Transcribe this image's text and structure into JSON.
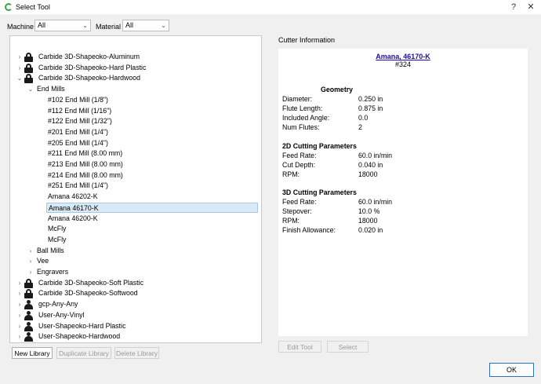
{
  "window": {
    "title": "Select Tool",
    "help_glyph": "?",
    "close_glyph": "✕"
  },
  "filters": {
    "machine_label": "Machine",
    "machine_value": "All",
    "material_label": "Material",
    "material_value": "All"
  },
  "tree": {
    "items": [
      {
        "label": "Carbide 3D-Shapeoko-Aluminum",
        "level": 0,
        "icon": "lock-icon",
        "expander": "›",
        "selected": false
      },
      {
        "label": "Carbide 3D-Shapeoko-Hard Plastic",
        "level": 0,
        "icon": "lock-icon",
        "expander": "›",
        "selected": false
      },
      {
        "label": "Carbide 3D-Shapeoko-Hardwood",
        "level": 0,
        "icon": "lock-icon",
        "expander": "⌄",
        "selected": false
      },
      {
        "label": "End Mills",
        "level": 1,
        "icon": "",
        "expander": "⌄",
        "selected": false
      },
      {
        "label": "#102 End Mill (1/8\")",
        "level": 2,
        "icon": "",
        "expander": "",
        "selected": false
      },
      {
        "label": "#112 End Mill (1/16\")",
        "level": 2,
        "icon": "",
        "expander": "",
        "selected": false
      },
      {
        "label": "#122 End Mill (1/32\")",
        "level": 2,
        "icon": "",
        "expander": "",
        "selected": false
      },
      {
        "label": "#201 End Mill (1/4\")",
        "level": 2,
        "icon": "",
        "expander": "",
        "selected": false
      },
      {
        "label": "#205 End Mill (1/4\")",
        "level": 2,
        "icon": "",
        "expander": "",
        "selected": false
      },
      {
        "label": "#211 End Mill (8.00 mm)",
        "level": 2,
        "icon": "",
        "expander": "",
        "selected": false
      },
      {
        "label": "#213 End Mill (8.00 mm)",
        "level": 2,
        "icon": "",
        "expander": "",
        "selected": false
      },
      {
        "label": "#214 End Mill (8.00 mm)",
        "level": 2,
        "icon": "",
        "expander": "",
        "selected": false
      },
      {
        "label": "#251 End Mill (1/4\")",
        "level": 2,
        "icon": "",
        "expander": "",
        "selected": false
      },
      {
        "label": "Amana 46202-K",
        "level": 2,
        "icon": "",
        "expander": "",
        "selected": false
      },
      {
        "label": "Amana 46170-K",
        "level": 2,
        "icon": "",
        "expander": "",
        "selected": true
      },
      {
        "label": "Amana 46200-K",
        "level": 2,
        "icon": "",
        "expander": "",
        "selected": false
      },
      {
        "label": "McFly",
        "level": 2,
        "icon": "",
        "expander": "",
        "selected": false
      },
      {
        "label": "McFly",
        "level": 2,
        "icon": "",
        "expander": "",
        "selected": false
      },
      {
        "label": "Ball Mills",
        "level": 1,
        "icon": "",
        "expander": "›",
        "selected": false
      },
      {
        "label": "Vee",
        "level": 1,
        "icon": "",
        "expander": "›",
        "selected": false
      },
      {
        "label": "Engravers",
        "level": 1,
        "icon": "",
        "expander": "›",
        "selected": false
      },
      {
        "label": "Carbide 3D-Shapeoko-Soft Plastic",
        "level": 0,
        "icon": "lock-icon",
        "expander": "›",
        "selected": false
      },
      {
        "label": "Carbide 3D-Shapeoko-Softwood",
        "level": 0,
        "icon": "lock-icon",
        "expander": "›",
        "selected": false
      },
      {
        "label": "gcp-Any-Any",
        "level": 0,
        "icon": "user-icon",
        "expander": "›",
        "selected": false
      },
      {
        "label": "User-Any-Vinyl",
        "level": 0,
        "icon": "user-icon",
        "expander": "›",
        "selected": false
      },
      {
        "label": "User-Shapeoko-Hard Plastic",
        "level": 0,
        "icon": "user-icon",
        "expander": "›",
        "selected": false
      },
      {
        "label": "User-Shapeoko-Hardwood",
        "level": 0,
        "icon": "user-icon",
        "expander": "›",
        "selected": false
      }
    ]
  },
  "library_buttons": {
    "new_label": "New Library",
    "duplicate_label": "Duplicate Library",
    "delete_label": "Delete Library"
  },
  "cutter": {
    "panel_title": "Cutter Information",
    "tool_name": "Amana, 46170-K",
    "tool_number": "#324",
    "sections": [
      {
        "title": "Geometry",
        "params": [
          {
            "label": "Diameter:",
            "value": "0.250 in"
          },
          {
            "label": "Flute Length:",
            "value": "0.875 in"
          },
          {
            "label": "Included Angle:",
            "value": "0.0"
          },
          {
            "label": "Num Flutes:",
            "value": "2"
          }
        ]
      },
      {
        "title": "2D Cutting Parameters",
        "params": [
          {
            "label": "Feed Rate:",
            "value": "60.0 in/min"
          },
          {
            "label": "Cut Depth:",
            "value": "0.040 in"
          },
          {
            "label": "RPM:",
            "value": "18000"
          }
        ]
      },
      {
        "title": "3D Cutting Parameters",
        "params": [
          {
            "label": "Feed Rate:",
            "value": "60.0 in/min"
          },
          {
            "label": "Stepover:",
            "value": "10.0 %"
          },
          {
            "label": "RPM:",
            "value": "18000"
          },
          {
            "label": "Finish Allowance:",
            "value": "0.020 in"
          }
        ]
      }
    ],
    "edit_label": "Edit Tool",
    "select_label": "Select"
  },
  "ok_label": "OK"
}
